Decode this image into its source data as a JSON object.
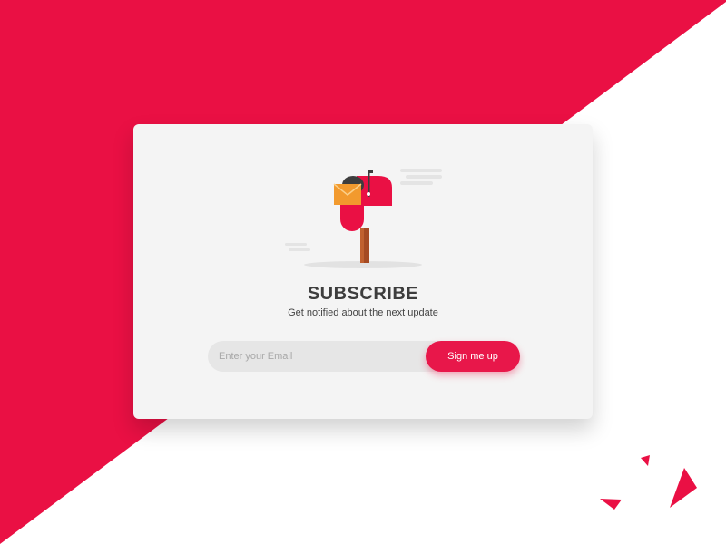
{
  "subscribe": {
    "title": "SUBSCRIBE",
    "subtitle": "Get notified about the next update",
    "email_placeholder": "Enter your Email",
    "button_label": "Sign me up"
  },
  "icons": {
    "illustration": "mailbox-illustration",
    "decor": "confetti-triangles"
  },
  "colors": {
    "brand": "#ea1044",
    "card_bg": "#f4f4f4",
    "input_bg": "#e6e6e6",
    "envelope": "#f29a2e"
  }
}
